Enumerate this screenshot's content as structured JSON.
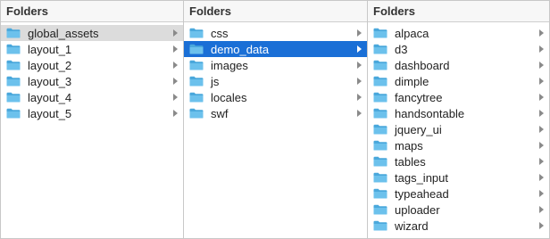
{
  "columns": [
    {
      "header": "Folders",
      "items": [
        {
          "label": "global_assets",
          "state": "selected-inactive",
          "chevron": true
        },
        {
          "label": "layout_1",
          "state": "normal",
          "chevron": true
        },
        {
          "label": "layout_2",
          "state": "normal",
          "chevron": true
        },
        {
          "label": "layout_3",
          "state": "normal",
          "chevron": true
        },
        {
          "label": "layout_4",
          "state": "normal",
          "chevron": true
        },
        {
          "label": "layout_5",
          "state": "normal",
          "chevron": true
        }
      ]
    },
    {
      "header": "Folders",
      "items": [
        {
          "label": "css",
          "state": "normal",
          "chevron": true
        },
        {
          "label": "demo_data",
          "state": "selected-active",
          "chevron": true
        },
        {
          "label": "images",
          "state": "normal",
          "chevron": true
        },
        {
          "label": "js",
          "state": "normal",
          "chevron": true
        },
        {
          "label": "locales",
          "state": "normal",
          "chevron": true
        },
        {
          "label": "swf",
          "state": "normal",
          "chevron": true
        }
      ]
    },
    {
      "header": "Folders",
      "items": [
        {
          "label": "alpaca",
          "state": "normal",
          "chevron": true
        },
        {
          "label": "d3",
          "state": "normal",
          "chevron": true
        },
        {
          "label": "dashboard",
          "state": "normal",
          "chevron": true
        },
        {
          "label": "dimple",
          "state": "normal",
          "chevron": true
        },
        {
          "label": "fancytree",
          "state": "normal",
          "chevron": true
        },
        {
          "label": "handsontable",
          "state": "normal",
          "chevron": true
        },
        {
          "label": "jquery_ui",
          "state": "normal",
          "chevron": true
        },
        {
          "label": "maps",
          "state": "normal",
          "chevron": true
        },
        {
          "label": "tables",
          "state": "normal",
          "chevron": true
        },
        {
          "label": "tags_input",
          "state": "normal",
          "chevron": true
        },
        {
          "label": "typeahead",
          "state": "normal",
          "chevron": true
        },
        {
          "label": "uploader",
          "state": "normal",
          "chevron": true
        },
        {
          "label": "wizard",
          "state": "normal",
          "chevron": true
        }
      ]
    }
  ],
  "icons": {
    "item": "folder-icon",
    "expand": "chevron-right-icon"
  },
  "colors": {
    "folder": "#6cc1ec",
    "folder_dark": "#4aa8dc",
    "selection_active": "#1a6fd6",
    "selection_inactive": "#dcdcdc",
    "chevron": "#8a8a8a",
    "header_bg": "#f7f7f7"
  }
}
